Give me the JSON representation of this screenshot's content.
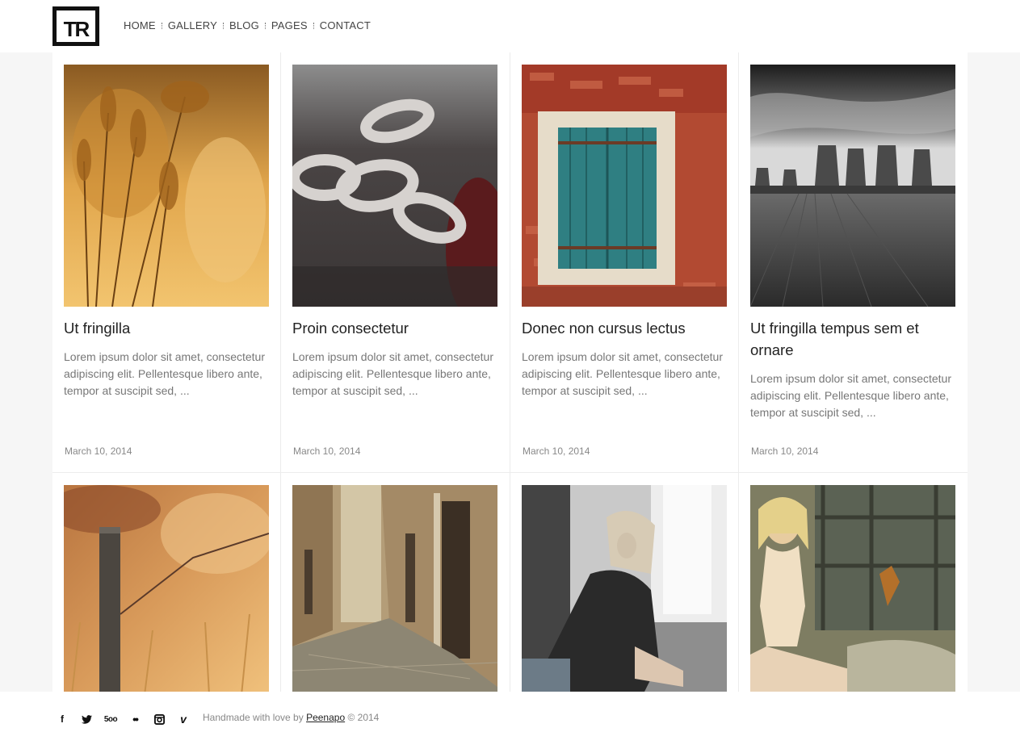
{
  "brand": {
    "logo_text": "TR"
  },
  "nav": {
    "items": [
      {
        "label": "HOME"
      },
      {
        "label": "GALLERY"
      },
      {
        "label": "BLOG"
      },
      {
        "label": "PAGES"
      },
      {
        "label": "CONTACT"
      }
    ]
  },
  "posts": [
    {
      "title": "Ut fringilla",
      "excerpt": "Lorem ipsum dolor sit amet, consectetur adipiscing elit. Pellentesque libero ante, tempor at suscipit sed, ...",
      "date": "March 10, 2014",
      "image": "golden-grass-photo"
    },
    {
      "title": "Proin consectetur",
      "excerpt": "Lorem ipsum dolor sit amet, consectetur adipiscing elit. Pellentesque libero ante, tempor at suscipit sed, ...",
      "date": "March 10, 2014",
      "image": "rusty-chain-photo"
    },
    {
      "title": "Donec non cursus lectus",
      "excerpt": "Lorem ipsum dolor sit amet, consectetur adipiscing elit. Pellentesque libero ante, tempor at suscipit sed, ...",
      "date": "March 10, 2014",
      "image": "teal-window-photo"
    },
    {
      "title": "Ut fringilla tempus sem et ornare",
      "excerpt": "Lorem ipsum dolor sit amet, consectetur adipiscing elit. Pellentesque libero ante, tempor at suscipit sed, ...",
      "date": "March 10, 2014",
      "image": "cooling-towers-photo"
    },
    {
      "image": "fence-post-photo"
    },
    {
      "image": "stone-alley-photo"
    },
    {
      "image": "woman-coat-photo"
    },
    {
      "image": "woman-window-photo"
    }
  ],
  "footer": {
    "social": [
      {
        "name": "facebook-icon",
        "glyph": "f"
      },
      {
        "name": "twitter-icon",
        "glyph": "🐦"
      },
      {
        "name": "500px-icon",
        "glyph": "5oo"
      },
      {
        "name": "flickr-icon",
        "glyph": "••"
      },
      {
        "name": "instagram-icon",
        "glyph": "◙"
      },
      {
        "name": "vimeo-icon",
        "glyph": "v"
      }
    ],
    "credit_prefix": "Handmade with love by",
    "credit_link": "Peenapo",
    "credit_suffix": "© 2014"
  }
}
